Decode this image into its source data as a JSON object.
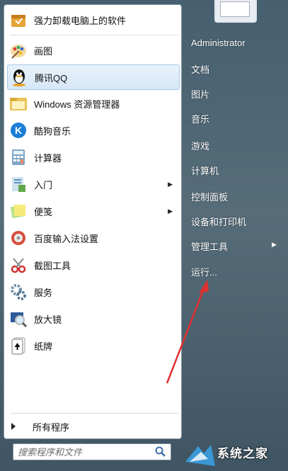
{
  "left_items": [
    {
      "label": "强力卸载电脑上的软件",
      "icon": "uninstall-icon"
    },
    {
      "label": "画图",
      "icon": "paint-icon"
    },
    {
      "label": "腾讯QQ",
      "icon": "qq-icon",
      "highlighted": true
    },
    {
      "label": "Windows 资源管理器",
      "icon": "explorer-icon"
    },
    {
      "label": "酷狗音乐",
      "icon": "kugou-icon"
    },
    {
      "label": "计算器",
      "icon": "calculator-icon"
    },
    {
      "label": "入门",
      "icon": "getting-started-icon",
      "submenu": true
    },
    {
      "label": "便笺",
      "icon": "sticky-notes-icon",
      "submenu": true
    },
    {
      "label": "百度输入法设置",
      "icon": "baidu-ime-icon"
    },
    {
      "label": "截图工具",
      "icon": "snipping-tool-icon"
    },
    {
      "label": "服务",
      "icon": "services-icon"
    },
    {
      "label": "放大镜",
      "icon": "magnifier-icon"
    },
    {
      "label": "纸牌",
      "icon": "solitaire-icon"
    }
  ],
  "all_programs": "所有程序",
  "search": {
    "placeholder": "搜索程序和文件"
  },
  "right_items": [
    {
      "label": "Administrator"
    },
    {
      "label": "文档"
    },
    {
      "label": "图片"
    },
    {
      "label": "音乐"
    },
    {
      "label": "游戏"
    },
    {
      "label": "计算机"
    },
    {
      "label": "控制面板"
    },
    {
      "label": "设备和打印机"
    },
    {
      "label": "管理工具",
      "submenu": true
    },
    {
      "label": "运行..."
    }
  ],
  "watermark": {
    "text": "系统之家"
  },
  "colors": {
    "annotation_arrow": "#e03131",
    "highlight": "#d6e7f8"
  }
}
